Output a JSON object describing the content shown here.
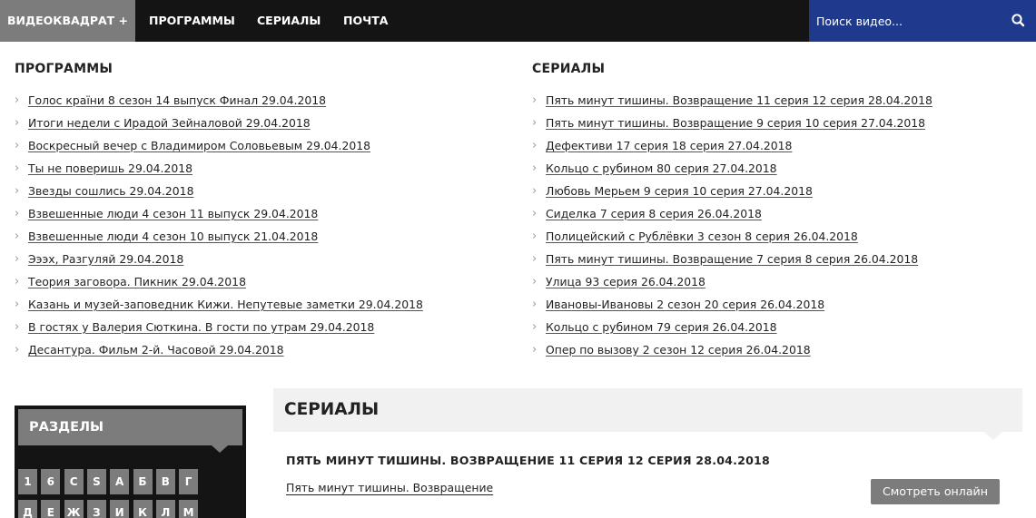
{
  "nav": {
    "brand": "ВИДЕОКВАДРАТ +",
    "links": [
      "ПРОГРАММЫ",
      "СЕРИАЛЫ",
      "ПОЧТА"
    ],
    "search_placeholder": "Поиск видео...",
    "search_icon": "search-icon",
    "colors": {
      "bar": "#141414",
      "brand_bg": "#7c7c7c",
      "search_bg": "#1f3a8c"
    }
  },
  "programs": {
    "heading": "ПРОГРАММЫ",
    "items": [
      "Голос країни 8 сезон 14 выпуск Финал 29.04.2018",
      "Итоги недели с Ирадой Зейналовой 29.04.2018",
      "Воскресный вечер с Владимиром Соловьевым 29.04.2018",
      "Ты не поверишь 29.04.2018",
      "Звезды сошлись 29.04.2018",
      "Взвешенные люди 4 сезон 11 выпуск 29.04.2018",
      "Взвешенные люди 4 сезон 10 выпуск 21.04.2018",
      "Эээх, Разгуляй 29.04.2018",
      "Теория заговора. Пикник 29.04.2018",
      "Казань и музей-заповедник Кижи. Непутевые заметки 29.04.2018",
      "В гостях у Валерия Сюткина. В гости по утрам 29.04.2018",
      "Десантура. Фильм 2-й. Часовой 29.04.2018"
    ]
  },
  "serials": {
    "heading": "СЕРИАЛЫ",
    "items": [
      "Пять минут тишины. Возвращение 11 серия 12 серия 28.04.2018",
      "Пять минут тишины. Возвращение 9 серия 10 серия 27.04.2018",
      "Дефективи 17 серия 18 серия 27.04.2018",
      "Кольцо с рубином 80 серия 27.04.2018",
      "Любовь Мерьем 9 серия 10 серия 27.04.2018",
      "Сиделка 7 серия 8 серия 26.04.2018",
      "Полицейский с Рублёвки 3 сезон 8 серия 26.04.2018",
      "Пять минут тишины. Возвращение 7 серия 8 серия 26.04.2018",
      "Улица 93 серия 26.04.2018",
      "Ивановы-Ивановы 2 сезон 20 серия 26.04.2018",
      "Кольцо с рубином 79 серия 26.04.2018",
      "Опер по вызову 2 сезон 12 серия 26.04.2018"
    ]
  },
  "sections": {
    "heading": "РАЗДЕЛЫ",
    "letters_row1": [
      "1",
      "6",
      "C",
      "S",
      "А",
      "Б",
      "В",
      "Г"
    ],
    "letters_row2": [
      "Д",
      "Е",
      "Ж",
      "З",
      "И",
      "К",
      "Л",
      "М"
    ]
  },
  "panel": {
    "heading": "СЕРИАЛЫ",
    "episode_title": "ПЯТЬ МИНУТ ТИШИНЫ. ВОЗВРАЩЕНИЕ 11 СЕРИЯ 12 СЕРИЯ 28.04.2018",
    "series_link": "Пять минут тишины. Возвращение",
    "watch_button": "Смотреть онлайн"
  }
}
